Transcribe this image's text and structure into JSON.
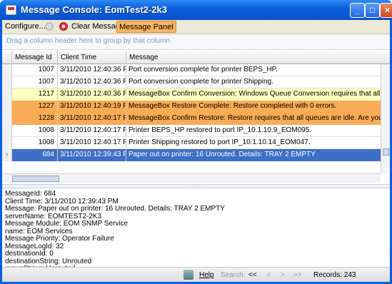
{
  "window": {
    "title": "Message Console: EomTest2-2k3"
  },
  "toolbar": {
    "configure_label": "Configure...",
    "clear_label": "Clear Messages",
    "panel_label": "Message Panel"
  },
  "group_hint": "Drag a column header here to group by that column",
  "grid": {
    "headers": [
      "Message Id",
      "Client Time",
      "Message"
    ],
    "rows": [
      {
        "id": "1007",
        "time": "3/11/2010 12:40:36 PM",
        "msg": "Port conversion complete for printer BEPS_HP.",
        "style": "normal"
      },
      {
        "id": "1007",
        "time": "3/11/2010 12:40:36 PM",
        "msg": "Port conversion complete for printer Shipping.",
        "style": "normal"
      },
      {
        "id": "1217",
        "time": "3/11/2010 12:40:36 PM",
        "msg": "MessageBox Confirm Conversion: Windows Queue Conversion requires that all queues are i",
        "style": "yellow"
      },
      {
        "id": "1227",
        "time": "3/11/2010 12:40:19 PM",
        "msg": "MessageBox Restore Complete: Restore completed with 0 errors.",
        "style": "orange"
      },
      {
        "id": "1228",
        "time": "3/11/2010 12:40:17 PM",
        "msg": "MessageBox Confirm Restore: Restore requires that all queues are idle.  Are you sure you w",
        "style": "orange"
      },
      {
        "id": "1008",
        "time": "3/11/2010 12:40:17 PM",
        "msg": "Printer BEPS_HP restored to port IP_10.1.10.9_EOM095.",
        "style": "normal"
      },
      {
        "id": "1008",
        "time": "3/11/2010 12:40:17 PM",
        "msg": "Printer Shipping restored to port IP_10.1.10.14_EOM047.",
        "style": "normal"
      },
      {
        "id": "684",
        "time": "3/11/2010 12:39:43 PM",
        "msg": "Paper out on printer: 16 Unrouted.  Details: TRAY 2 EMPTY",
        "style": "selected",
        "marker": "›"
      }
    ]
  },
  "detail": {
    "lines": [
      "MessageId: 684",
      "Client Time: 3/11/2010 12:39:43 PM",
      "Message: Paper out on printer: 16 Unrouted.  Details: TRAY 2 EMPTY",
      "serverName: EOMTEST2-2K3",
      "Message Module: EOM SNMP Service",
      "name: EOM Services",
      "Message Priority: Operator Failure",
      "MessageLogId: 32",
      "destinationId: 0",
      "destinationString: Unrouted",
      "groupString: Unrouted"
    ]
  },
  "statusbar": {
    "help": "Help",
    "search": "Search",
    "first": "<<",
    "prev": "<",
    "next": ">",
    "last": ">>",
    "records": "Records: 243"
  },
  "colors": {
    "titlebar": "#0a5fdc",
    "highlight_yellow": "#ffffc0",
    "highlight_orange": "#f9ac55",
    "selection": "#3d6fc6"
  }
}
